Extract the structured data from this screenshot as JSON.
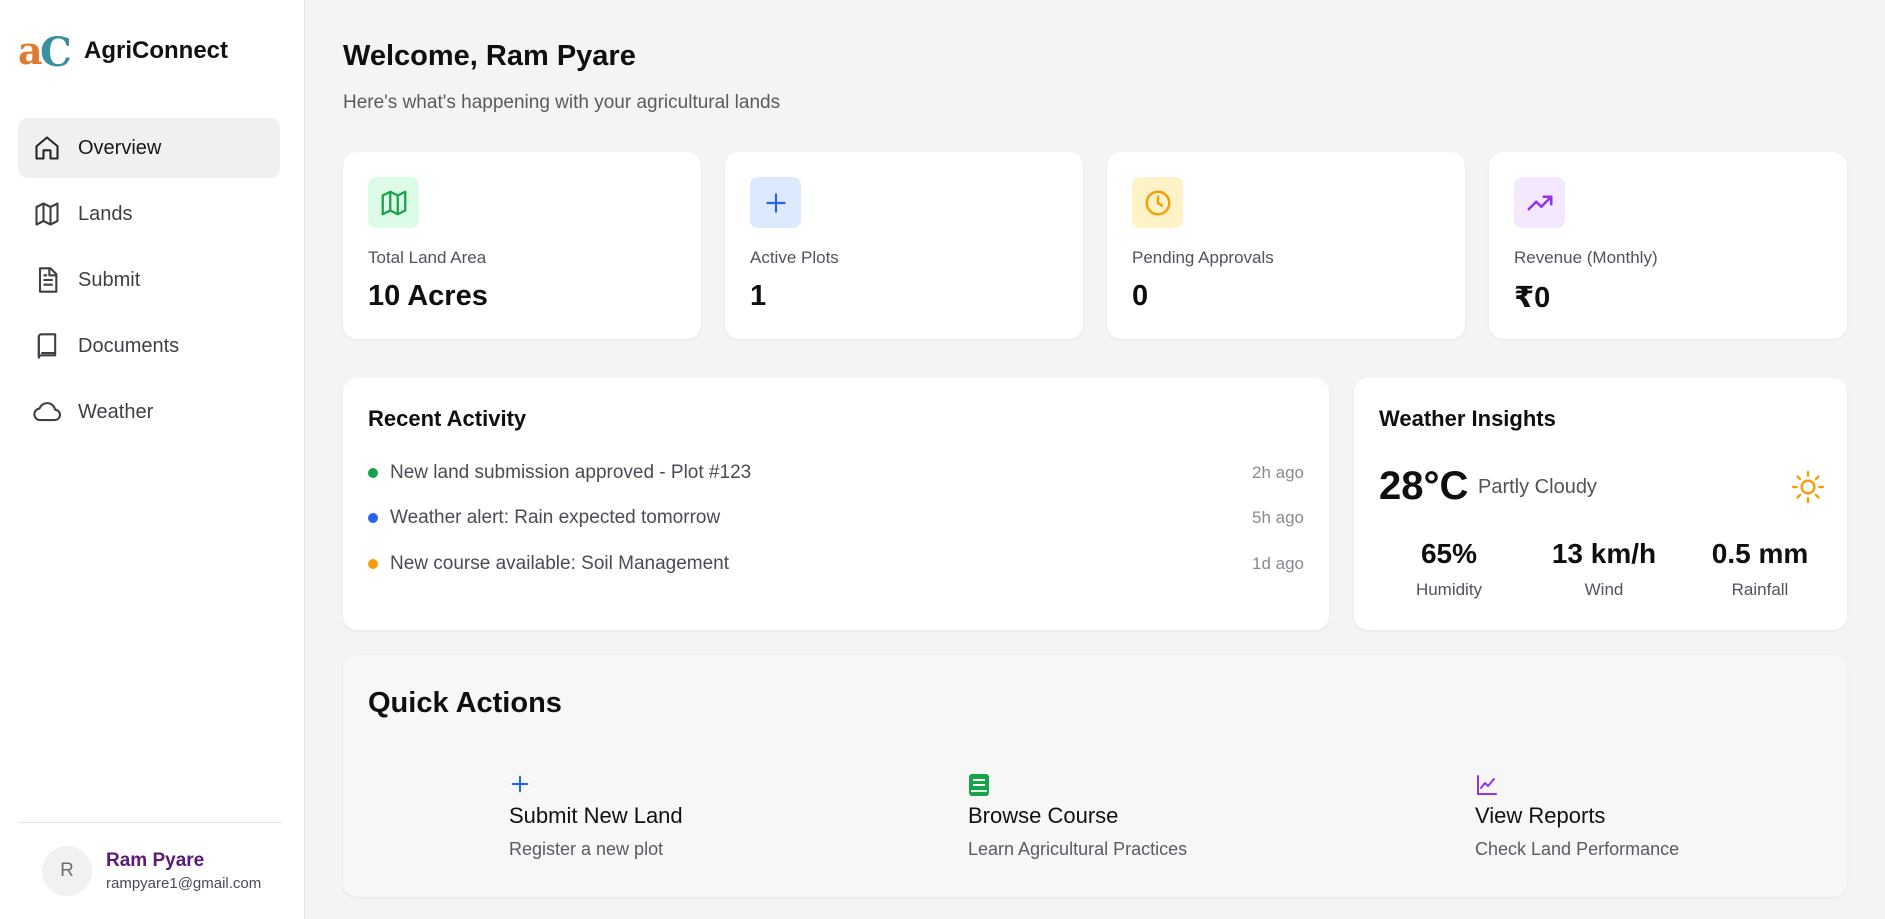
{
  "brand": {
    "name": "AgriConnect"
  },
  "sidebar": {
    "items": [
      {
        "label": "Overview",
        "icon": "home-icon",
        "active": true
      },
      {
        "label": "Lands",
        "icon": "map-icon",
        "active": false
      },
      {
        "label": "Submit",
        "icon": "document-icon",
        "active": false
      },
      {
        "label": "Documents",
        "icon": "book-icon",
        "active": false
      },
      {
        "label": "Weather",
        "icon": "cloud-icon",
        "active": false
      }
    ]
  },
  "user": {
    "initial": "R",
    "name": "Ram Pyare",
    "email": "rampyare1@gmail.com"
  },
  "header": {
    "title": "Welcome, Ram Pyare",
    "subtitle": "Here's what's happening with your agricultural lands"
  },
  "stats": [
    {
      "label": "Total Land Area",
      "value": "10 Acres",
      "icon": "map-icon",
      "color": "#16a34a",
      "bg": "#dcfce7"
    },
    {
      "label": "Active Plots",
      "value": "1",
      "icon": "plus-icon",
      "color": "#2563eb",
      "bg": "#dbeafe"
    },
    {
      "label": "Pending Approvals",
      "value": "0",
      "icon": "clock-icon",
      "color": "#f59e0b",
      "bg": "#fef3c7"
    },
    {
      "label": "Revenue (Monthly)",
      "value": "₹0",
      "icon": "trending-up-icon",
      "color": "#9333ea",
      "bg": "#f3e8ff"
    }
  ],
  "activity": {
    "title": "Recent Activity",
    "items": [
      {
        "text": "New land submission approved - Plot #123",
        "time": "2h ago",
        "color": "#16a34a"
      },
      {
        "text": "Weather alert: Rain expected tomorrow",
        "time": "5h ago",
        "color": "#2563eb"
      },
      {
        "text": "New course available: Soil Management",
        "time": "1d ago",
        "color": "#f59e0b"
      }
    ]
  },
  "weather": {
    "title": "Weather Insights",
    "temperature": "28°C",
    "condition": "Partly Cloudy",
    "icon": "sun-icon",
    "stats": [
      {
        "value": "65%",
        "label": "Humidity"
      },
      {
        "value": "13 km/h",
        "label": "Wind"
      },
      {
        "value": "0.5 mm",
        "label": "Rainfall"
      }
    ]
  },
  "quick_actions": {
    "title": "Quick Actions",
    "items": [
      {
        "title": "Submit New Land",
        "desc": "Register a new plot",
        "icon": "plus-icon",
        "color": "#2563eb"
      },
      {
        "title": "Browse Course",
        "desc": "Learn Agricultural Practices",
        "icon": "book-icon",
        "color": "#16a34a"
      },
      {
        "title": "View Reports",
        "desc": "Check Land Performance",
        "icon": "chart-line-icon",
        "color": "#9333ea"
      }
    ]
  }
}
